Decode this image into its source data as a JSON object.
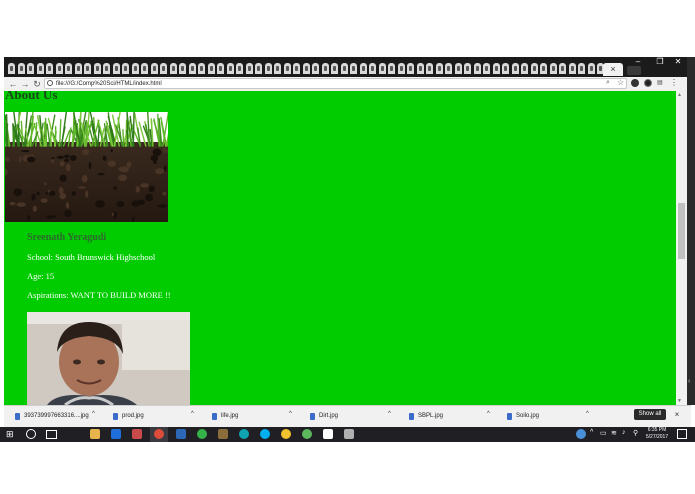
{
  "browser": {
    "tab_count_visible": 64,
    "active_tab_close": "×",
    "url": "file:///G:/Comp%20Sci/HTML/index.html",
    "window_controls": [
      "minimize",
      "restore",
      "close"
    ]
  },
  "page": {
    "heading": "About Us",
    "name": "Sreenath Yeragudi",
    "school": "School: South Brunswick Highschool",
    "age": "Age: 15",
    "aspirations": "Aspirations: WANT TO BUILD MORE !!",
    "background_color": "#00cc00"
  },
  "downloads": {
    "items": [
      {
        "name": "393739997663316....jpg"
      },
      {
        "name": "prod.jpg"
      },
      {
        "name": "life.jpg"
      },
      {
        "name": "Dirt.jpg"
      },
      {
        "name": "SBPL.jpg"
      },
      {
        "name": "Soilo.jpg"
      }
    ],
    "show_all": "Show all",
    "close": "×"
  },
  "taskbar": {
    "time": "6:35 PM",
    "date": "5/27/2017"
  }
}
